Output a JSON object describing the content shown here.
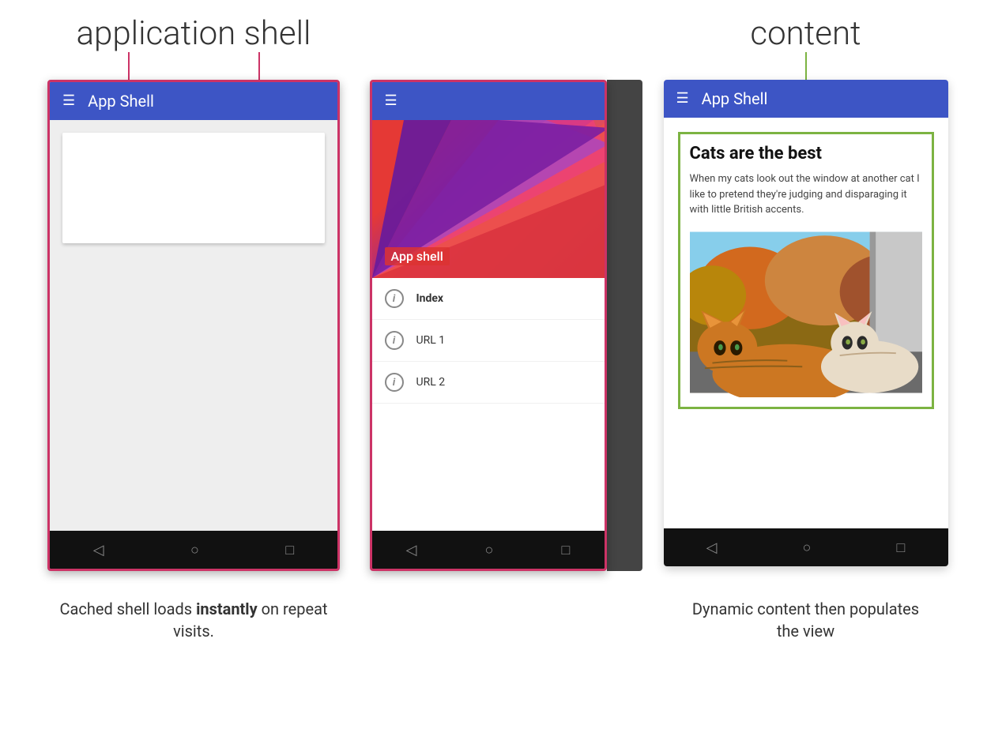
{
  "page": {
    "bg_color": "#ffffff"
  },
  "left_label": "application shell",
  "right_label": "content",
  "left_phone": {
    "toolbar_title": "App Shell",
    "nav_back": "◁",
    "nav_home": "○",
    "nav_recent": "□"
  },
  "middle_phone": {
    "drawer_app_label": "App shell",
    "items": [
      {
        "label": "Index",
        "bold": true
      },
      {
        "label": "URL 1",
        "bold": false
      },
      {
        "label": "URL 2",
        "bold": false
      }
    ],
    "nav_back": "◁",
    "nav_home": "○",
    "nav_recent": "□"
  },
  "right_phone": {
    "toolbar_title": "App Shell",
    "content_title": "Cats are the best",
    "content_text": "When my cats look out the window at another cat I like to pretend they're judging and disparaging it with little British accents.",
    "nav_back": "◁",
    "nav_home": "○",
    "nav_recent": "□"
  },
  "left_caption": {
    "text_before": "Cached shell loads ",
    "text_bold": "instantly",
    "text_after": " on repeat visits."
  },
  "right_caption": "Dynamic content then populates the view"
}
